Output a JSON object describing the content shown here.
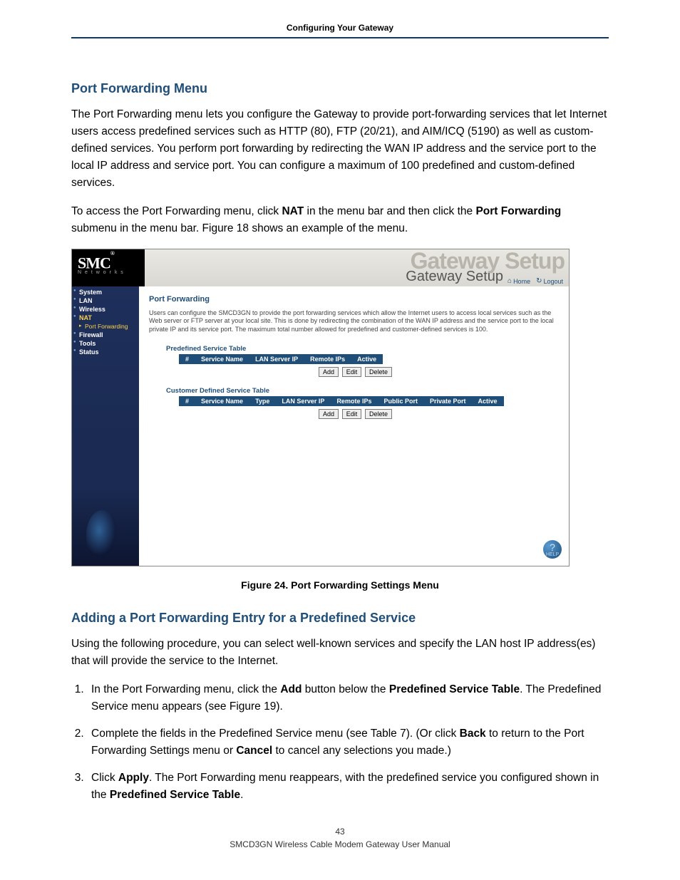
{
  "header": {
    "title": "Configuring Your Gateway"
  },
  "section1": {
    "heading": "Port Forwarding Menu",
    "para1": "The Port Forwarding menu lets you configure the Gateway to provide port-forwarding services that let Internet users access predefined services such as HTTP (80), FTP (20/21), and AIM/ICQ (5190) as well as custom-defined services. You perform port forwarding by redirecting the WAN IP address and the service port to the local IP address and service port. You can configure a maximum of 100 predefined and custom-defined services.",
    "para2_pre": "To access the Port Forwarding menu, click ",
    "para2_b1": "NAT",
    "para2_mid": " in the menu bar and then click the ",
    "para2_b2": "Port Forwarding",
    "para2_post": " submenu in the menu bar. Figure 18 shows an example of the menu."
  },
  "app": {
    "brand": "SMC",
    "brand_reg": "®",
    "brand_sub": "N e t w o r k s",
    "banner_ghost": "Gateway Setup",
    "banner_label": "Gateway Setup",
    "link_home": "Home",
    "link_logout": "Logout",
    "nav": {
      "system": "System",
      "lan": "LAN",
      "wireless": "Wireless",
      "nat": "NAT",
      "portfwd": "Port Forwarding",
      "firewall": "Firewall",
      "tools": "Tools",
      "status": "Status"
    },
    "content": {
      "title": "Port Forwarding",
      "desc": "Users can configure the SMCD3GN to provide the port forwarding services which allow the Internet users to access local services such as the Web server or FTP server at your local site. This is done by redirecting the combination of the WAN IP address and the service port to the local private IP and its service port. The maximum total number allowed for predefined and customer-defined services is 100.",
      "predef_title": "Predefined Service Table",
      "cust_title": "Customer Defined Service Table",
      "predef_cols": {
        "num": "#",
        "name": "Service Name",
        "lan": "LAN Server IP",
        "remote": "Remote IPs",
        "active": "Active"
      },
      "cust_cols": {
        "num": "#",
        "name": "Service Name",
        "type": "Type",
        "lan": "LAN Server IP",
        "remote": "Remote IPs",
        "pub": "Public Port",
        "priv": "Private Port",
        "active": "Active"
      },
      "btn_add": "Add",
      "btn_edit": "Edit",
      "btn_delete": "Delete",
      "help": "HELP"
    }
  },
  "figcap": "Figure 24. Port Forwarding Settings Menu",
  "section2": {
    "heading": "Adding a Port Forwarding Entry for a Predefined Service",
    "para": "Using the following procedure, you can select well-known services and specify the LAN host IP address(es) that will provide the service to the Internet.",
    "steps": {
      "s1_pre": "In the Port Forwarding menu, click the ",
      "s1_b1": "Add",
      "s1_mid": " button below the ",
      "s1_b2": "Predefined Service Table",
      "s1_post": ". The Predefined Service menu appears (see Figure 19).",
      "s2_pre": "Complete the fields in the Predefined Service menu (see Table 7). (Or click ",
      "s2_b1": "Back",
      "s2_mid": " to return to the Port Forwarding Settings menu or ",
      "s2_b2": "Cancel",
      "s2_post": " to cancel any selections you made.)",
      "s3_pre": "Click ",
      "s3_b1": "Apply",
      "s3_mid": ". The Port Forwarding menu reappears, with the predefined service you configured shown in the ",
      "s3_b2": "Predefined Service Table",
      "s3_post": "."
    }
  },
  "footer": {
    "pagenum": "43",
    "manual": "SMCD3GN Wireless Cable Modem Gateway User Manual"
  }
}
